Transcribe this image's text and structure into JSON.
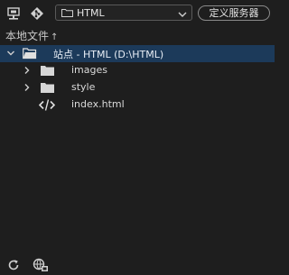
{
  "toolbar": {
    "site_dropdown_value": "HTML",
    "server_button_label": "定义服务器"
  },
  "panel": {
    "local_files_label": "本地文件",
    "sort_arrow": "↑"
  },
  "tree": {
    "root": {
      "label": "站点 - HTML (D:\\HTML)"
    },
    "children": [
      {
        "label": "images"
      },
      {
        "label": "style"
      },
      {
        "label": "index.html"
      }
    ]
  },
  "colors": {
    "background": "#1e1e1e",
    "selection": "#1c3a5a",
    "text": "#cfcfcf"
  }
}
